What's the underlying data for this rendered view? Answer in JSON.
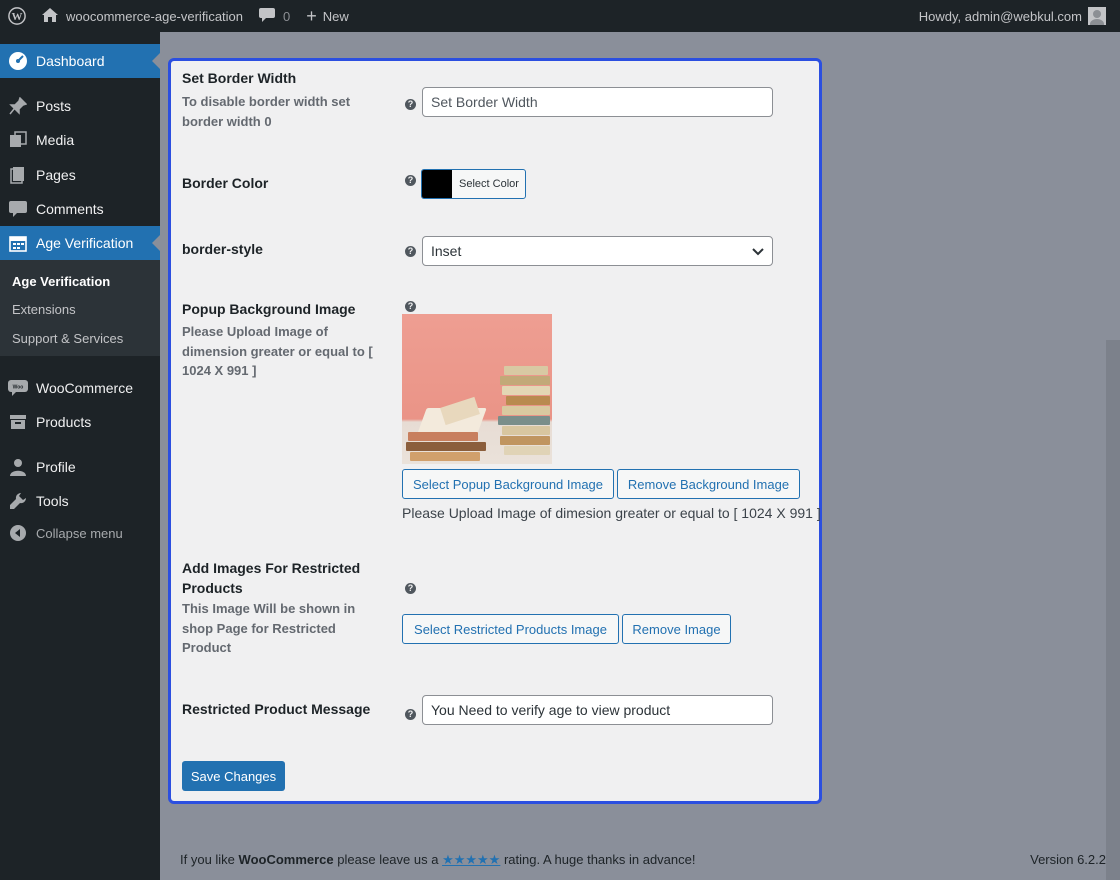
{
  "adminbar": {
    "site_name": "woocommerce-age-verification",
    "comments_count": "0",
    "new_label": "New",
    "howdy": "Howdy, admin@webkul.com"
  },
  "sidebar": {
    "items": [
      {
        "label": "Dashboard",
        "icon": "dashboard-icon"
      },
      {
        "label": "Posts",
        "icon": "pin-icon"
      },
      {
        "label": "Media",
        "icon": "media-icon"
      },
      {
        "label": "Pages",
        "icon": "pages-icon"
      },
      {
        "label": "Comments",
        "icon": "comment-icon"
      },
      {
        "label": "Age Verification",
        "icon": "calendar-icon"
      },
      {
        "label": "WooCommerce",
        "icon": "woo-icon"
      },
      {
        "label": "Products",
        "icon": "archive-icon"
      },
      {
        "label": "Profile",
        "icon": "user-icon"
      },
      {
        "label": "Tools",
        "icon": "wrench-icon"
      },
      {
        "label": "Collapse menu",
        "icon": "collapse-icon"
      }
    ],
    "submenu": [
      "Age Verification",
      "Extensions",
      "Support & Services"
    ]
  },
  "form": {
    "border_width": {
      "label": "Set Border Width",
      "desc_line1": "To disable border width set",
      "desc_line2": "border width 0",
      "placeholder": "Set Border Width"
    },
    "border_color": {
      "label": "Border Color",
      "button": "Select Color",
      "value": "#000000"
    },
    "border_style": {
      "label": "border-style",
      "value": "Inset"
    },
    "popup_bg": {
      "label": "Popup Background Image",
      "desc_line1": "Please Upload Image of",
      "desc_line2": "dimension greater or equal to [",
      "desc_line3": "1024 X 991 ]",
      "select_button": "Select Popup Background Image",
      "remove_button": "Remove Background Image",
      "note": "Please Upload Image of dimesion greater or equal to [ 1024 X 991 ]"
    },
    "restricted_images": {
      "label_line1": "Add Images For Restricted",
      "label_line2": "Products",
      "desc_line1": "This Image Will be shown in",
      "desc_line2": "shop Page for Restricted",
      "desc_line3": "Product",
      "select_button": "Select Restricted Products Image",
      "remove_button": "Remove Image"
    },
    "restricted_message": {
      "label": "Restricted Product Message",
      "value": "You Need to verify age to view product"
    },
    "save_button": "Save Changes"
  },
  "footer": {
    "text_before": "If you like ",
    "brand": "WooCommerce",
    "text_mid": " please leave us a ",
    "stars": "★★★★★",
    "text_after": " rating. A huge thanks in advance!",
    "version": "Version 6.2.2"
  }
}
